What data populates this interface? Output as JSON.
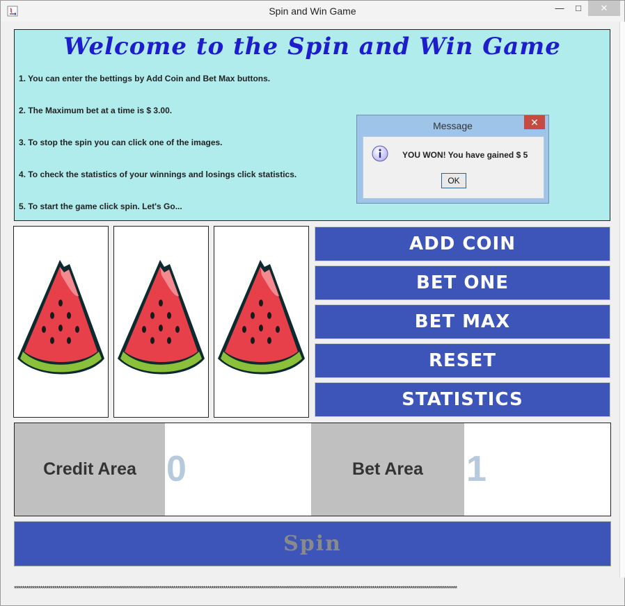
{
  "window": {
    "title": "Spin and Win Game",
    "controls": {
      "minimize": "—",
      "maximize": "□",
      "close": "✕"
    }
  },
  "welcome": {
    "title": "Welcome to the Spin and Win Game",
    "instructions": [
      "1. You can enter the bettings by Add Coin and Bet Max buttons.",
      "2. The Maximum bet at a time is $ 3.00.",
      "3. To stop the spin you can click one of the images.",
      "4. To check the statistics of your winnings and losings click statistics.",
      "5. To start the game click spin. Let's Go..."
    ]
  },
  "reels": [
    {
      "icon": "watermelon-icon"
    },
    {
      "icon": "watermelon-icon"
    },
    {
      "icon": "watermelon-icon"
    }
  ],
  "buttons": {
    "add_coin": "ADD COIN",
    "bet_one": "BET ONE",
    "bet_max": "BET MAX",
    "reset": "RESET",
    "statistics": "STATISTICS"
  },
  "areas": {
    "credit_label": "Credit Area",
    "credit_value": "0",
    "bet_label": "Bet Area",
    "bet_value": "1"
  },
  "spin_label": "Spin",
  "footer_stars": "****************************************************************************************************************************************************************************************************************************",
  "dialog": {
    "title": "Message",
    "close": "✕",
    "message": "YOU WON! You have gained $ 5",
    "ok_label": "OK",
    "icon": "info-icon"
  },
  "colors": {
    "panel_bg": "#b0ecec",
    "button_bg": "#3d55b8",
    "title_text": "#1d1dcc",
    "area_label_bg": "#c0c0c0",
    "area_value_text": "#b7c9dc"
  }
}
